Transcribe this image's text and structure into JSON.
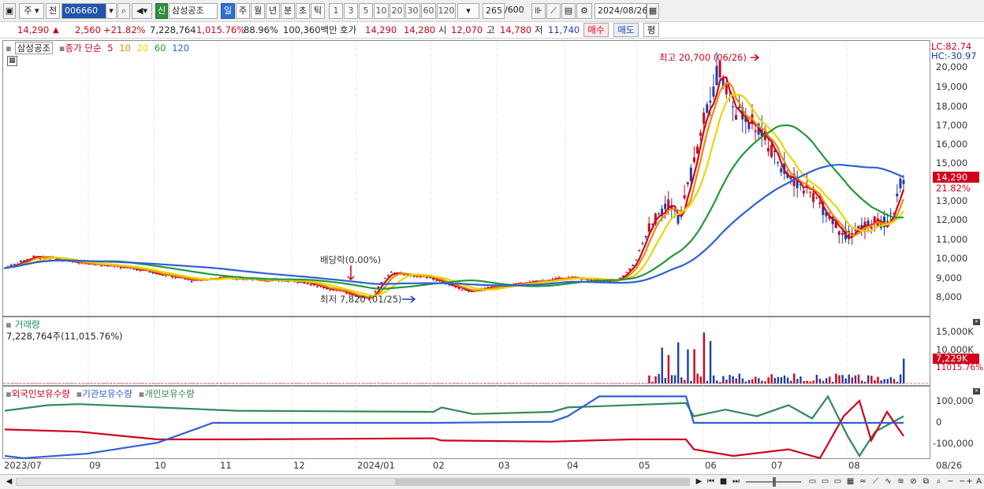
{
  "toolbar": {
    "period_label": "주",
    "prev_label": "전",
    "stock_code": "006660",
    "new_label": "신",
    "stock_name": "삼성공조",
    "intervals": [
      "일",
      "주",
      "월",
      "년",
      "분",
      "초",
      "틱"
    ],
    "counts": [
      "1",
      "3",
      "5",
      "10",
      "20",
      "30",
      "60",
      "120"
    ],
    "display_count": "265",
    "total_count": "/600",
    "date": "2024/08/26"
  },
  "quote": {
    "price": "14,290",
    "change_arrow": "▲",
    "change": "2,560",
    "change_pct": "+21.82%",
    "volume": "7,228,764",
    "volume_ratio": "1,015.76%",
    "rate": "88.96%",
    "amount": "100,360백만",
    "ask_label": "호가",
    "ask": "14,290",
    "bid": "14,280",
    "open_label": "시",
    "open": "12,070",
    "high_label": "고",
    "high": "14,780",
    "low_label": "저",
    "low": "11,740",
    "buy_label": "매수",
    "sell_label": "매도",
    "avg_label": "평"
  },
  "price_panel": {
    "legend_name": "삼성공조",
    "legend_close": "종가 단순",
    "ma": [
      {
        "label": "5",
        "color": "#d0021b"
      },
      {
        "label": "10",
        "color": "#f08a00"
      },
      {
        "label": "20",
        "color": "#e6d800"
      },
      {
        "label": "60",
        "color": "#1f9a3a"
      },
      {
        "label": "120",
        "color": "#2f5fd8"
      }
    ],
    "lc": "LC:82.74",
    "hc": "HC:-30.97",
    "high_annotation": "최고 20,700 (06/26)",
    "low_annotation": "최저 7,820 (01/25)",
    "dividend_annotation": "배당락(0.00%)",
    "y_ticks": [
      "20,000",
      "19,000",
      "18,000",
      "17,000",
      "16,000",
      "15,000",
      "13,000",
      "12,000",
      "11,000",
      "10,000",
      "9,000",
      "8,000"
    ],
    "current_price_tag": "14,290",
    "current_pct_tag": "21.82%"
  },
  "volume_panel": {
    "legend": "거래량",
    "value": "7,228,764주(11,015.76%)",
    "y_ticks": [
      "15,000K",
      "10,000K"
    ],
    "current_tag": "7,229K",
    "current_pct_tag": "11015.76%"
  },
  "holdings_panel": {
    "legend_foreign": "외국인보유수량",
    "legend_inst": "기관보유수량",
    "legend_indiv": "개인보유수량",
    "y_ticks": [
      "100,000",
      "0",
      "-100,000"
    ]
  },
  "x_axis": [
    "2023/07",
    "09",
    "10",
    "11",
    "12",
    "2024/01",
    "02",
    "03",
    "04",
    "05",
    "06",
    "07",
    "08",
    "08/26"
  ],
  "colors": {
    "up": "#d0021b",
    "down": "#1a3fa8",
    "foreign": "#d0021b",
    "institution": "#2f5fd8",
    "individual": "#2e8b57"
  }
}
